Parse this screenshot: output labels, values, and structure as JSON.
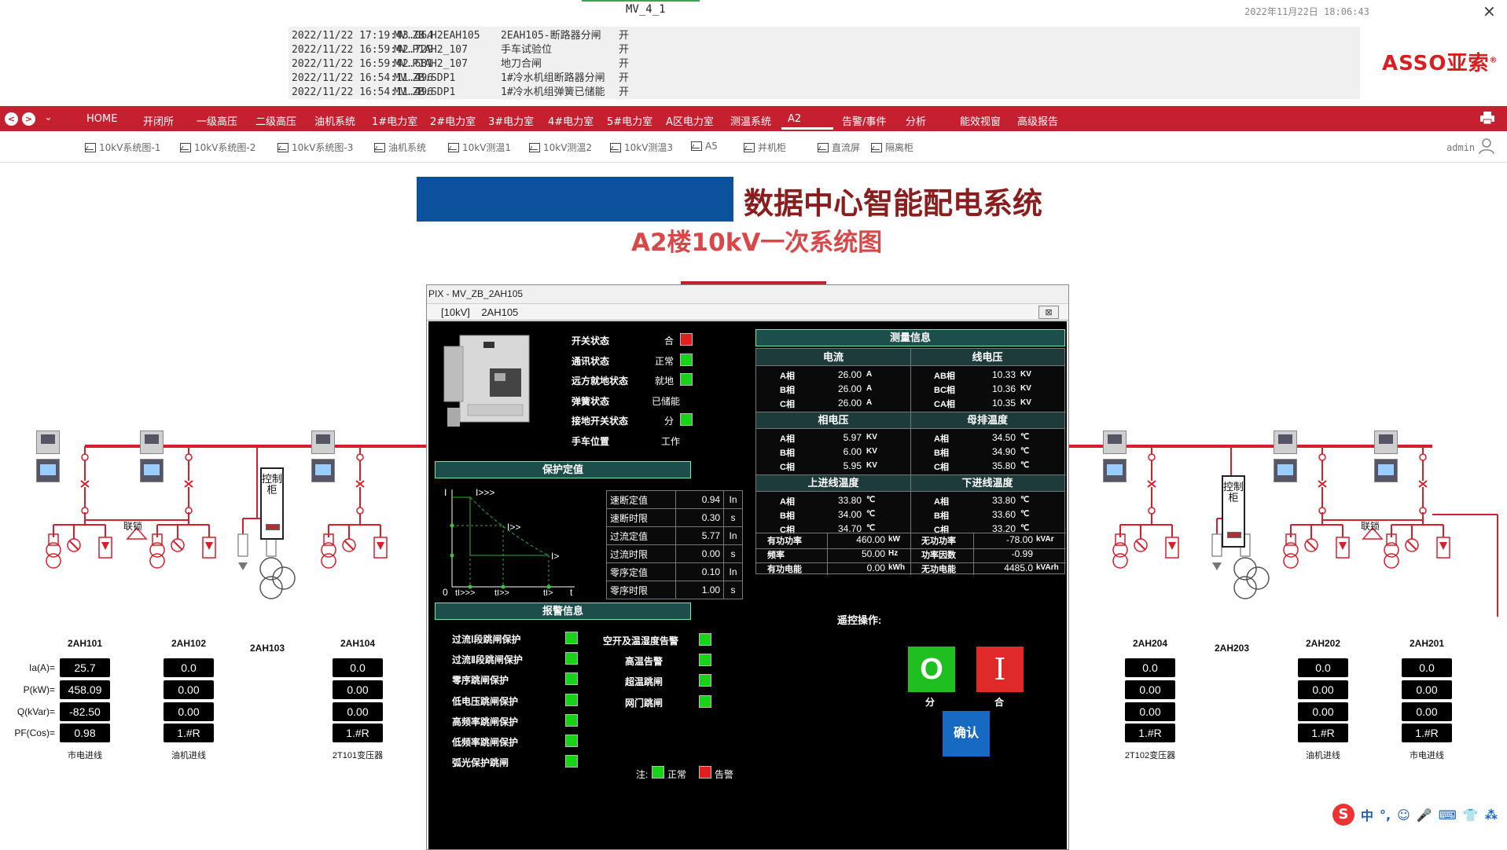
{
  "window": {
    "title": "MV_4_1",
    "datetime": "2022年11月22日 18:06:43",
    "close": "×"
  },
  "event_log": [
    {
      "time": "2022/11/22 17:19:43.064",
      "device": "MV.ZB.H2EAH105",
      "text": "2EAH105-断路器分闸",
      "state": "开"
    },
    {
      "time": "2022/11/22 16:59:42.729",
      "device": "MV.P1AH2_107",
      "text": "手车试验位",
      "state": "开"
    },
    {
      "time": "2022/11/22 16:59:42.681",
      "device": "MV.P1AH2_107",
      "text": "地刀合闸",
      "state": "开"
    },
    {
      "time": "2022/11/22 16:54:11.496",
      "device": "MV.ZB.SDP1",
      "text": "1#冷水机组断路器分闸",
      "state": "开"
    },
    {
      "time": "2022/11/22 16:54:11.496",
      "device": "MV.ZB.SDP1",
      "text": "1#冷水机组弹簧已储能",
      "state": "开"
    }
  ],
  "logo": {
    "text": "ASSO亚索",
    "mark": "®"
  },
  "nav": {
    "back": "<",
    "forward": ">",
    "menu": "⌄",
    "items": [
      "HOME",
      "开闭所",
      "一级高压",
      "二级高压",
      "油机系统",
      "1#电力室",
      "2#电力室",
      "3#电力室",
      "4#电力室",
      "5#电力室",
      "A区电力室",
      "测温系统",
      "A2",
      "告警/事件",
      "分析",
      "能效视窗",
      "高级报告"
    ],
    "active": "A2"
  },
  "subnav": {
    "items": [
      "10kV系统图-1",
      "10kV系统图-2",
      "10kV系统图-3",
      "油机系统",
      "10kV测温1",
      "10kV测温2",
      "10kV测温3",
      "A5",
      "并机柜",
      "直流屏",
      "隔离柜"
    ],
    "user": "admin"
  },
  "page": {
    "title": "数据中心智能配电系统",
    "subtitle": "A2楼10kV一次系统图"
  },
  "diagram": {
    "row_labels": [
      "Ia(A)=",
      "P(kW)=",
      "Q(kVar)=",
      "PF(Cos)="
    ],
    "interlock": "联锁",
    "control_cabinet": "控制柜",
    "feeders": [
      {
        "name": "2AH101",
        "values": [
          "25.7",
          "458.09",
          "-82.50",
          "0.98"
        ],
        "desc": "市电进线"
      },
      {
        "name": "2AH102",
        "values": [
          "0.0",
          "0.00",
          "0.00",
          "1.#R"
        ],
        "desc": "油机进线"
      },
      {
        "name": "2AH103",
        "values": [],
        "desc": ""
      },
      {
        "name": "2AH104",
        "values": [
          "0.0",
          "0.00",
          "0.00",
          "1.#R"
        ],
        "desc": "2T101变压器"
      },
      {
        "name": "2AH204",
        "values": [
          "0.0",
          "0.00",
          "0.00",
          "1.#R"
        ],
        "desc": "2T102变压器"
      },
      {
        "name": "2AH203",
        "values": [],
        "desc": ""
      },
      {
        "name": "2AH202",
        "values": [
          "0.0",
          "0.00",
          "0.00",
          "1.#R"
        ],
        "desc": "油机进线"
      },
      {
        "name": "2AH201",
        "values": [
          "0.0",
          "0.00",
          "0.00",
          "1.#R"
        ],
        "desc": "市电进线"
      }
    ]
  },
  "dialog": {
    "title": "PIX - MV_ZB_2AH105",
    "tab_level": "[10kV]",
    "tab_device": "2AH105",
    "close": "⊠",
    "status": [
      {
        "label": "开关状态",
        "value": "合",
        "color": "r"
      },
      {
        "label": "通讯状态",
        "value": "正常",
        "color": "g"
      },
      {
        "label": "远方就地状态",
        "value": "就地",
        "color": "g"
      },
      {
        "label": "弹簧状态",
        "value": "已储能",
        "color": ""
      },
      {
        "label": "接地开关状态",
        "value": "分",
        "color": "g"
      },
      {
        "label": "手车位置",
        "value": "工作",
        "color": ""
      }
    ],
    "protection": {
      "header": "保护定值",
      "curve_labels": {
        "y": "I",
        "i3": "I>>>",
        "i2": "I>>",
        "i1": "I>",
        "origin": "0",
        "t3": "tI>>>",
        "t2": "tI>>",
        "t1": "tI>",
        "x": "t"
      },
      "rows": [
        {
          "label": "速断定值",
          "value": "0.94",
          "unit": "In"
        },
        {
          "label": "速断时限",
          "value": "0.30",
          "unit": "s"
        },
        {
          "label": "过流定值",
          "value": "5.77",
          "unit": "In"
        },
        {
          "label": "过流时限",
          "value": "0.00",
          "unit": "s"
        },
        {
          "label": "零序定值",
          "value": "0.10",
          "unit": "In"
        },
        {
          "label": "零序时限",
          "value": "1.00",
          "unit": "s"
        }
      ]
    },
    "alarms": {
      "header": "报警信息",
      "left": [
        "过流Ⅰ段跳闸保护",
        "过流Ⅱ段跳闸保护",
        "零序跳闸保护",
        "低电压跳闸保护",
        "高频率跳闸保护",
        "低频率跳闸保护",
        "弧光保护跳闸"
      ],
      "right": [
        "空开及温湿度告警",
        "高温告警",
        "超温跳闸",
        "网门跳闸"
      ],
      "legend_prefix": "注:",
      "legend_normal": "正常",
      "legend_alarm": "告警"
    },
    "measure": {
      "header": "测量信息",
      "current": {
        "title": "电流",
        "rows": [
          [
            "A相",
            "26.00",
            "A"
          ],
          [
            "B相",
            "26.00",
            "A"
          ],
          [
            "C相",
            "26.00",
            "A"
          ]
        ]
      },
      "line_voltage": {
        "title": "线电压",
        "rows": [
          [
            "AB相",
            "10.33",
            "KV"
          ],
          [
            "BC相",
            "10.36",
            "KV"
          ],
          [
            "CA相",
            "10.35",
            "KV"
          ]
        ]
      },
      "phase_voltage": {
        "title": "相电压",
        "rows": [
          [
            "A相",
            "5.97",
            "KV"
          ],
          [
            "B相",
            "6.00",
            "KV"
          ],
          [
            "C相",
            "5.95",
            "KV"
          ]
        ]
      },
      "bus_temp": {
        "title": "母排温度",
        "rows": [
          [
            "A相",
            "34.50",
            "℃"
          ],
          [
            "B相",
            "34.90",
            "℃"
          ],
          [
            "C相",
            "35.80",
            "℃"
          ]
        ]
      },
      "in_temp": {
        "title": "上进线温度",
        "rows": [
          [
            "A相",
            "33.80",
            "℃"
          ],
          [
            "B相",
            "34.00",
            "℃"
          ],
          [
            "C相",
            "34.70",
            "℃"
          ]
        ]
      },
      "out_temp": {
        "title": "下进线温度",
        "rows": [
          [
            "A相",
            "33.80",
            "℃"
          ],
          [
            "B相",
            "33.60",
            "℃"
          ],
          [
            "C相",
            "33.20",
            "℃"
          ]
        ]
      },
      "power": [
        [
          "有功功率",
          "460.00",
          "kW",
          "无功功率",
          "-78.00",
          "kVAr"
        ],
        [
          "频率",
          "50.00",
          "Hz",
          "功率因数",
          "-0.99",
          ""
        ],
        [
          "有功电能",
          "0.00",
          "kWh",
          "无功电能",
          "4485.0",
          "kVArh"
        ]
      ]
    },
    "remote": {
      "label": "遥控操作:",
      "open": "O",
      "open_label": "分",
      "close": "I",
      "close_label": "合",
      "confirm": "确认"
    }
  },
  "ime": {
    "logo": "S",
    "items": [
      "中",
      "°,",
      "☺",
      "🎤",
      "⌨",
      "👕",
      "⁂"
    ]
  },
  "colors": {
    "nav": "#c62030",
    "bus": "#d81e2a",
    "title_blue": "#0c519b",
    "normal": "#19d319",
    "alarm": "#e02020"
  }
}
